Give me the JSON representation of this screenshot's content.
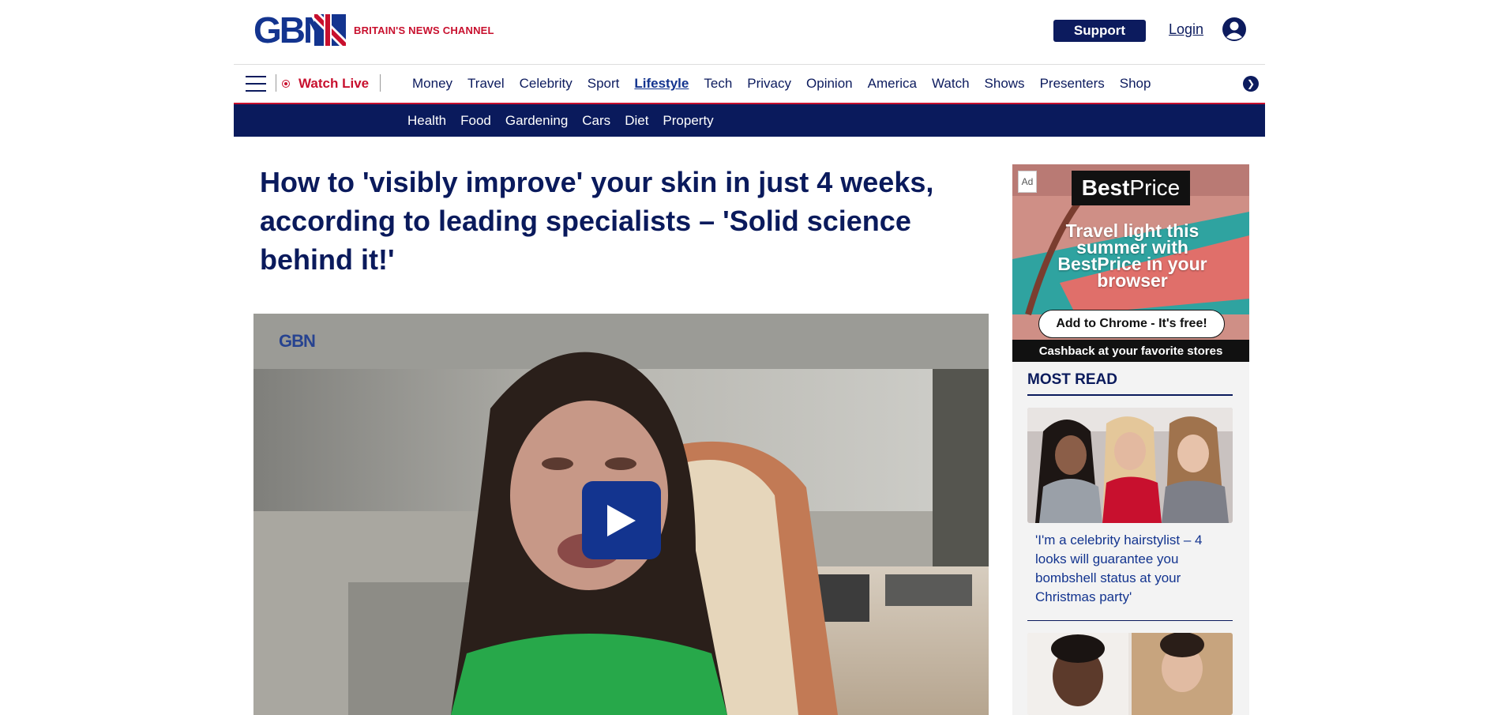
{
  "header": {
    "logo_text": "GBN",
    "tagline": "BRITAIN'S NEWS CHANNEL",
    "support_label": "Support",
    "login_label": "Login"
  },
  "nav": {
    "watch_live": "Watch Live",
    "items": [
      "Money",
      "Travel",
      "Celebrity",
      "Sport",
      "Lifestyle",
      "Tech",
      "Privacy",
      "Opinion",
      "America",
      "Watch",
      "Shows",
      "Presenters",
      "Shop"
    ],
    "active_item": "Lifestyle"
  },
  "subnav": {
    "items": [
      "Health",
      "Food",
      "Gardening",
      "Cars",
      "Diet",
      "Property"
    ]
  },
  "article": {
    "headline": "How to 'visibly improve' your skin in just 4 weeks, according to leading specialists – 'Solid science behind it!'",
    "video_watermark": "GBN"
  },
  "ad": {
    "badge": "Ad",
    "brand_bold": "Best",
    "brand_rest": "Price",
    "copy": "Travel light this summer with BestPrice in your browser",
    "cta": "Add to Chrome - It's free!",
    "footer": "Cashback at your favorite stores"
  },
  "most_read": {
    "title": "MOST READ",
    "items": [
      {
        "caption": "'I'm a celebrity hairstylist – 4 looks will guarantee you bombshell status at your Christmas party'"
      }
    ]
  },
  "colors": {
    "brand_navy": "#0a1a5c",
    "brand_blue": "#13348f",
    "brand_red": "#c8102e"
  },
  "icons": [
    "hamburger-icon",
    "live-dot-icon",
    "chevron-right-icon",
    "user-icon",
    "play-icon"
  ]
}
